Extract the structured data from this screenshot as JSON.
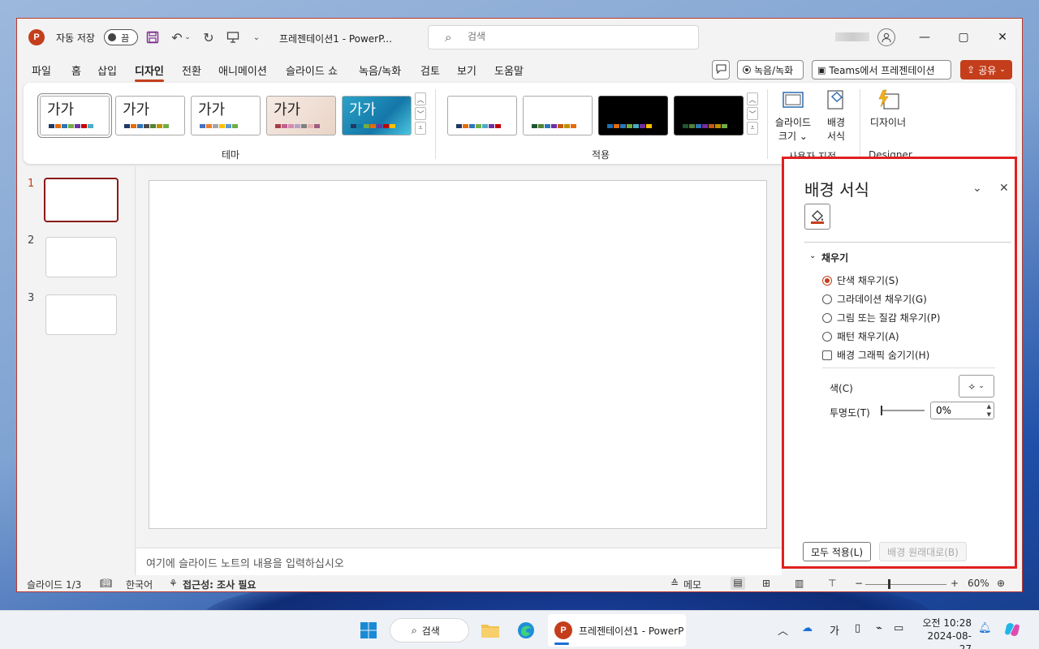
{
  "window": {
    "autosave_label": "자동 저장",
    "autosave_state": "끔",
    "doc_title": "프레젠테이션1  -  PowerP...",
    "search_placeholder": "검색"
  },
  "tabs": [
    "파일",
    "홈",
    "삽입",
    "디자인",
    "전환",
    "애니메이션",
    "슬라이드 쇼",
    "녹음/녹화",
    "검토",
    "보기",
    "도움말"
  ],
  "active_tab": "디자인",
  "header_buttons": {
    "record": "녹음/녹화",
    "teams": "Teams에서 프레젠테이션",
    "share": "공유"
  },
  "ribbon": {
    "theme_text": "가가",
    "theme_group_label": "테마",
    "variants_group_label": "적용",
    "slide_size_label_1": "슬라이드",
    "slide_size_label_2": "크기",
    "format_bg_label_1": "배경",
    "format_bg_label_2": "서식",
    "customize_group_label": "사용자 지정",
    "designer_label": "디자이너",
    "designer_group_label": "Designer"
  },
  "slides": [
    "1",
    "2",
    "3"
  ],
  "notes_placeholder": "여기에 슬라이드 노트의 내용을 입력하십시오",
  "pane": {
    "title": "배경 서식",
    "section": "채우기",
    "options": [
      "단색 채우기(S)",
      "그라데이션 채우기(G)",
      "그림 또는 질감 채우기(P)",
      "패턴 채우기(A)"
    ],
    "selected_option": 0,
    "hide_graphics": "배경 그래픽 숨기기(H)",
    "color_label": "색(C)",
    "transparency_label": "투명도(T)",
    "transparency_value": "0%",
    "apply_all": "모두 적용(L)",
    "reset": "배경 원래대로(B)"
  },
  "status": {
    "slide_info": "슬라이드 1/3",
    "language": "한국어",
    "accessibility": "접근성: 조사 필요",
    "notes": "메모",
    "zoom": "60%"
  },
  "taskbar": {
    "search": "검색",
    "app_label": "프레젠테이션1 - PowerP",
    "ime": "가",
    "time": "오전 10:28",
    "date": "2024-08-27"
  },
  "colors": {
    "accent": "#c43e1c",
    "highlight_border": "#e02020"
  }
}
